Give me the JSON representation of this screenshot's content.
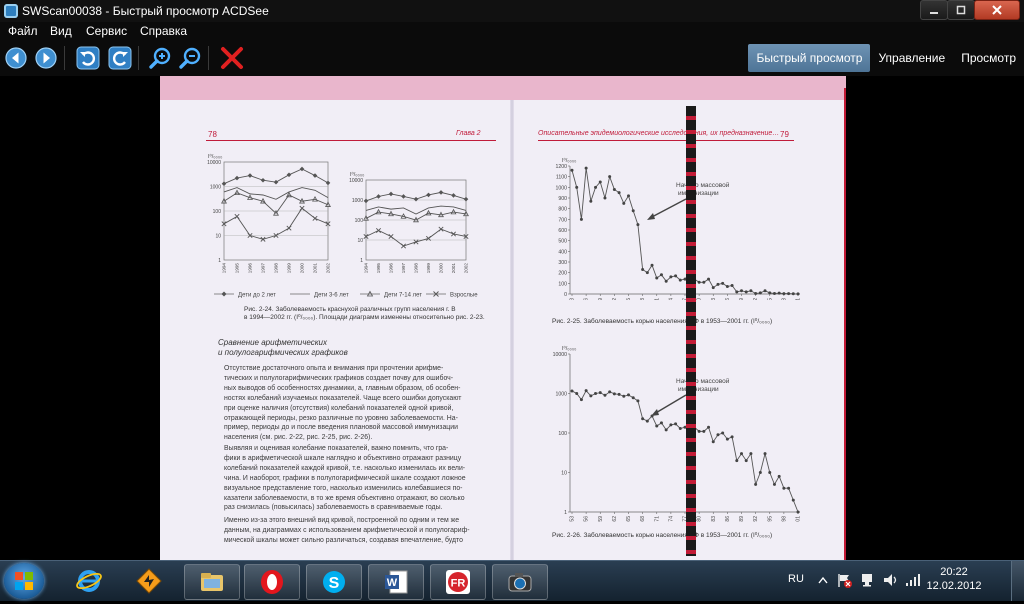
{
  "window": {
    "title": "SWScan00038 - Быстрый просмотр ACDSee",
    "icon": "acdsee-app-icon"
  },
  "window_buttons": [
    "minimize-icon",
    "maximize-icon",
    "close-icon"
  ],
  "menu": [
    "Файл",
    "Вид",
    "Сервис",
    "Справка"
  ],
  "toolbar": {
    "buttons": [
      "back-icon",
      "forward-icon",
      "rotate-left-icon",
      "rotate-right-icon",
      "zoom-in-icon",
      "zoom-out-icon",
      "delete-icon"
    ],
    "tabs": [
      {
        "label": "Быстрый просмотр",
        "active": true
      },
      {
        "label": "Управление",
        "active": false
      },
      {
        "label": "Просмотр",
        "active": false
      }
    ]
  },
  "document": {
    "left": {
      "page_number": "78",
      "chapter": "Глава 2",
      "fig24_caption_1": "Рис. 2-24. Заболеваемость краснухой различных групп населения г. В",
      "fig24_caption_2": "в 1994—2002 гг. (I⁰/₀₀₀₀). Площади диаграмм изменены относительно рис. 2-23.",
      "legend": [
        "Дети до 2 лет",
        "Дети 3-6 лет",
        "Дети 7-14 лет",
        "Взрослые"
      ],
      "section_title_1": "Сравнение арифметических",
      "section_title_2": "и полулогарифмических графиков",
      "para1": [
        "Отсутствие достаточного опыта и внимания при прочтении арифме-",
        "тических и полулогарифмических графиков создает почву для ошибоч-",
        "ных выводов об особенностях динамики, а, главным образом, об особен-",
        "ностях колебаний изучаемых показателей. Чаще всего ошибки допускают",
        "при оценке наличия (отсутствия) колебаний показателей одной кривой,",
        "отражающей периоды, резко различные по уровню заболеваемости. На-",
        "пример, периоды до и после введения плановой массовой иммунизации",
        "населения (см. рис. 2-22, рис. 2-25, рис. 2-26)."
      ],
      "para2": [
        "Выявляя и оценивая колебание показателей, важно помнить, что гра-",
        "фики в арифметической шкале наглядно и объективно отражают разницу",
        "колебаний показателей каждой кривой, т.е. насколько изменилась их вели-",
        "чина. И наоборот, графики в полулогарифмической шкале создают ложное",
        "визуальное представление того, насколько изменились колебавшиеся по-",
        "казатели заболеваемости, в то же время объективно отражают, во сколько",
        "раз снизилась (повысилась) заболеваемость в сравниваемые годы."
      ],
      "para3": [
        "Именно из-за этого внешний вид кривой, построенной по одним и тем же",
        "данным, на диаграммах с использованием арифметической и полулогариф-",
        "мической шкалы может сильно различаться, создавая впечатление, будто"
      ]
    },
    "right": {
      "header": "Описательные эпидемиологические исследования, их предназначение…",
      "page_number": "79",
      "fig25_caption": "Рис. 2-25. Заболеваемость корью населения РФ в 1953—2001 гг. (I⁰/₀₀₀₀)",
      "fig26_caption": "Рис. 2-26. Заболеваемость корью населения РФ в 1953—2001 гг. (I⁰/₀₀₀₀)",
      "annotation_1": "Начало массовой",
      "annotation_2": "иммунизации"
    }
  },
  "chart_data": [
    {
      "type": "line",
      "title": "Рис. 2-24 (левая диаграмма)",
      "ylabel": "I⁰/₀₀₀₀",
      "yscale": "log",
      "ylim": [
        1,
        10000
      ],
      "y_ticks": [
        "1",
        "10",
        "100",
        "1000",
        "10000"
      ],
      "categories": [
        "1994",
        "1995",
        "1996",
        "1997",
        "1998",
        "1999",
        "2000",
        "2001",
        "2002"
      ],
      "series": [
        {
          "values": [
            1300,
            2200,
            2800,
            1800,
            1500,
            3000,
            5200,
            2800,
            1400
          ]
        },
        {
          "values": [
            600,
            900,
            500,
            450,
            300,
            600,
            900,
            700,
            350
          ]
        },
        {
          "values": [
            250,
            550,
            350,
            250,
            80,
            450,
            250,
            300,
            180
          ]
        },
        {
          "values": [
            30,
            60,
            10,
            7,
            10,
            20,
            130,
            50,
            30
          ]
        }
      ]
    },
    {
      "type": "line",
      "title": "Рис. 2-24 (правая диаграмма)",
      "ylabel": "I⁰/₀₀₀₀",
      "yscale": "log",
      "ylim": [
        1,
        10000
      ],
      "y_ticks": [
        "1",
        "10",
        "100",
        "1000",
        "10000"
      ],
      "categories": [
        "1994",
        "1995",
        "1996",
        "1997",
        "1998",
        "1999",
        "2000",
        "2001",
        "2002"
      ],
      "series": [
        {
          "values": [
            900,
            1500,
            2000,
            1500,
            1100,
            1800,
            2400,
            1700,
            1100
          ]
        },
        {
          "values": [
            300,
            450,
            350,
            400,
            200,
            400,
            500,
            450,
            300
          ]
        },
        {
          "values": [
            120,
            250,
            200,
            150,
            100,
            220,
            180,
            250,
            200
          ]
        },
        {
          "values": [
            15,
            30,
            15,
            5,
            8,
            12,
            35,
            20,
            15
          ]
        }
      ]
    },
    {
      "type": "line",
      "title": "Рис. 2-25",
      "ylabel": "I⁰/₀₀₀₀",
      "yscale": "linear",
      "ylim": [
        0,
        1200
      ],
      "y_ticks": [
        "0",
        "100",
        "200",
        "300",
        "400",
        "500",
        "600",
        "700",
        "800",
        "900",
        "1000",
        "1100",
        "1200"
      ],
      "x_ticks": [
        "53",
        "56",
        "59",
        "62",
        "65",
        "68",
        "71",
        "74",
        "77",
        "80",
        "83",
        "86",
        "89",
        "92",
        "95",
        "98",
        "01"
      ],
      "x": [
        1953,
        1954,
        1955,
        1956,
        1957,
        1958,
        1959,
        1960,
        1961,
        1962,
        1963,
        1964,
        1965,
        1966,
        1967,
        1968,
        1969,
        1970,
        1971,
        1972,
        1973,
        1974,
        1975,
        1976,
        1977,
        1978,
        1979,
        1980,
        1981,
        1982,
        1983,
        1984,
        1985,
        1986,
        1987,
        1988,
        1989,
        1990,
        1991,
        1992,
        1993,
        1994,
        1995,
        1996,
        1997,
        1998,
        1999,
        2000,
        2001
      ],
      "values": [
        1160,
        1000,
        700,
        1180,
        870,
        1000,
        1050,
        900,
        1100,
        980,
        950,
        850,
        920,
        780,
        650,
        230,
        200,
        270,
        150,
        180,
        120,
        160,
        170,
        130,
        140,
        190,
        140,
        110,
        110,
        140,
        60,
        90,
        100,
        70,
        80,
        20,
        30,
        20,
        30,
        5,
        10,
        30,
        10,
        5,
        8,
        4,
        4,
        2,
        1
      ]
    },
    {
      "type": "line",
      "title": "Рис. 2-26",
      "ylabel": "I⁰/₀₀₀₀",
      "yscale": "log",
      "ylim": [
        1,
        10000
      ],
      "y_ticks": [
        "1",
        "10",
        "100",
        "1000",
        "10000"
      ],
      "x_ticks": [
        "53",
        "56",
        "59",
        "62",
        "65",
        "68",
        "71",
        "74",
        "77",
        "80",
        "83",
        "86",
        "89",
        "92",
        "95",
        "98",
        "01"
      ],
      "x": [
        1953,
        1954,
        1955,
        1956,
        1957,
        1958,
        1959,
        1960,
        1961,
        1962,
        1963,
        1964,
        1965,
        1966,
        1967,
        1968,
        1969,
        1970,
        1971,
        1972,
        1973,
        1974,
        1975,
        1976,
        1977,
        1978,
        1979,
        1980,
        1981,
        1982,
        1983,
        1984,
        1985,
        1986,
        1987,
        1988,
        1989,
        1990,
        1991,
        1992,
        1993,
        1994,
        1995,
        1996,
        1997,
        1998,
        1999,
        2000,
        2001
      ],
      "values": [
        1160,
        1000,
        700,
        1180,
        870,
        1000,
        1050,
        900,
        1100,
        980,
        950,
        850,
        920,
        780,
        650,
        230,
        200,
        270,
        150,
        180,
        120,
        160,
        170,
        130,
        140,
        190,
        140,
        110,
        110,
        140,
        60,
        90,
        100,
        70,
        80,
        20,
        30,
        20,
        30,
        5,
        10,
        30,
        10,
        5,
        8,
        4,
        4,
        2,
        1
      ]
    }
  ],
  "taskbar": {
    "pinned": [
      "windows-start-icon",
      "internet-explorer-icon",
      "winamp-icon"
    ],
    "running": [
      "file-explorer-icon",
      "opera-icon",
      "skype-icon",
      "word-icon",
      "finereader-icon",
      "acdsee-icon"
    ],
    "language": "RU",
    "time": "20:22",
    "date": "12.02.2012"
  }
}
